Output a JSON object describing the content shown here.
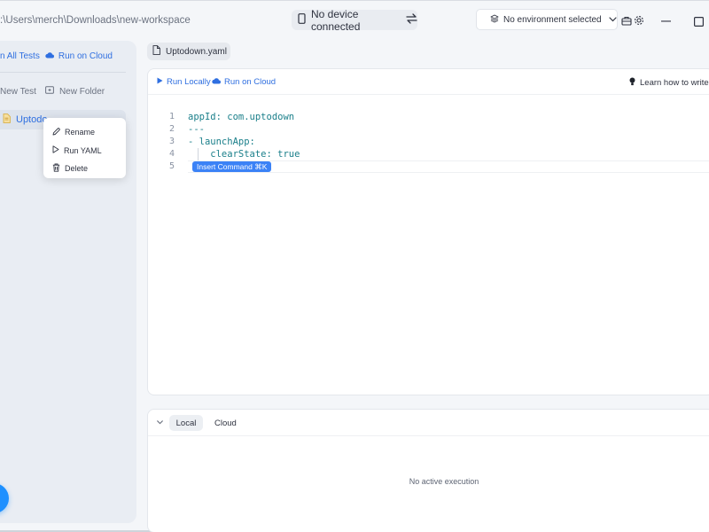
{
  "titlebar": {
    "path": ":\\Users\\merch\\Downloads\\new-workspace",
    "device": "No device connected",
    "environment": "No environment selected"
  },
  "sidebar": {
    "run_all": "n All Tests",
    "run_cloud": "Run on Cloud",
    "new_test": "New Test",
    "new_folder": "New Folder",
    "file_name": "Uptodo"
  },
  "context_menu": {
    "rename": "Rename",
    "run_yaml": "Run YAML",
    "delete": "Delete"
  },
  "editor": {
    "tab_name": "Uptodown.yaml",
    "run_locally": "Run Locally",
    "run_on_cloud": "Run on Cloud",
    "learn": "Learn how to write",
    "lines": [
      {
        "num": "1",
        "text": "appId: com.uptodown"
      },
      {
        "num": "2",
        "text": "---"
      },
      {
        "num": "3",
        "text": "- launchApp:"
      },
      {
        "num": "4",
        "text": "    clearState: true"
      },
      {
        "num": "5",
        "text": ""
      }
    ],
    "insert_command": "Insert Command ⌘K"
  },
  "execution": {
    "tab_local": "Local",
    "tab_cloud": "Cloud",
    "empty_text": "No active execution"
  },
  "colors": {
    "accent": "#2f6fe0",
    "fab": "#1e90ff",
    "insert_bg": "#3b82f6"
  }
}
